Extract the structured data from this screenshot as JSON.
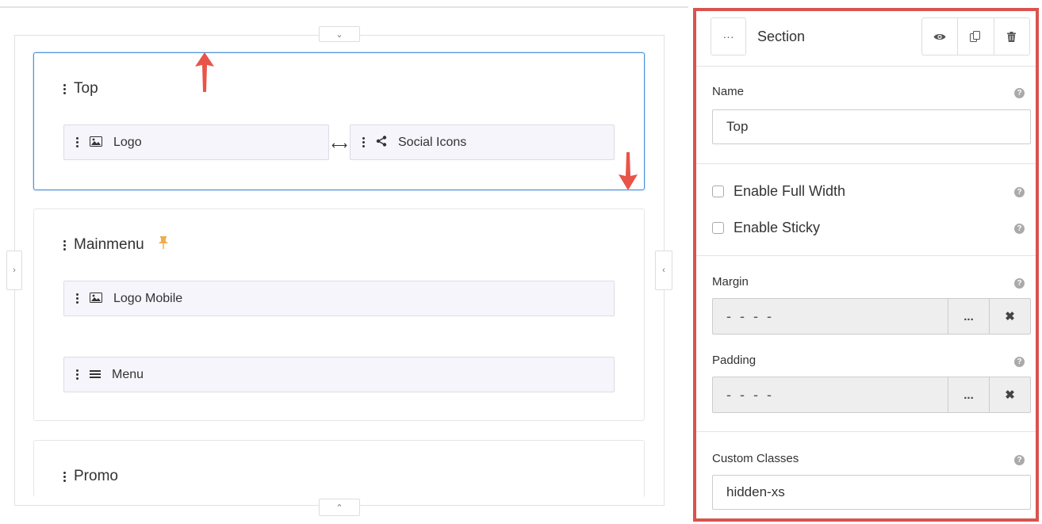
{
  "canvas": {
    "sections": [
      {
        "title": "Top",
        "rows": [
          {
            "label": "Logo",
            "icon": "image-icon"
          },
          {
            "label": "Social Icons",
            "icon": "share-icon"
          }
        ]
      },
      {
        "title": "Mainmenu",
        "rows": [
          {
            "label": "Logo Mobile",
            "icon": "image-icon"
          },
          {
            "label": "Menu",
            "icon": "menu-icon"
          }
        ]
      },
      {
        "title": "Promo",
        "rows": []
      }
    ],
    "collapse_top_icon": "⌄",
    "collapse_bottom_icon": "⌃",
    "left_toggle": "›",
    "right_toggle": "‹",
    "resize_icon": "⟷"
  },
  "panel": {
    "more_label": "···",
    "title": "Section",
    "name_label": "Name",
    "name_value": "Top",
    "enable_full_width": "Enable Full Width",
    "enable_sticky": "Enable Sticky",
    "margin_label": "Margin",
    "margin_value": "- - - -",
    "padding_label": "Padding",
    "padding_value": "- - - -",
    "custom_classes_label": "Custom Classes",
    "custom_classes_value": "hidden-xs",
    "ellipsis": "...",
    "clear": "✖",
    "help": "?"
  },
  "colors": {
    "accent": "#4a90d9",
    "highlight": "#d9534f",
    "pin": "#f0ad4e"
  }
}
